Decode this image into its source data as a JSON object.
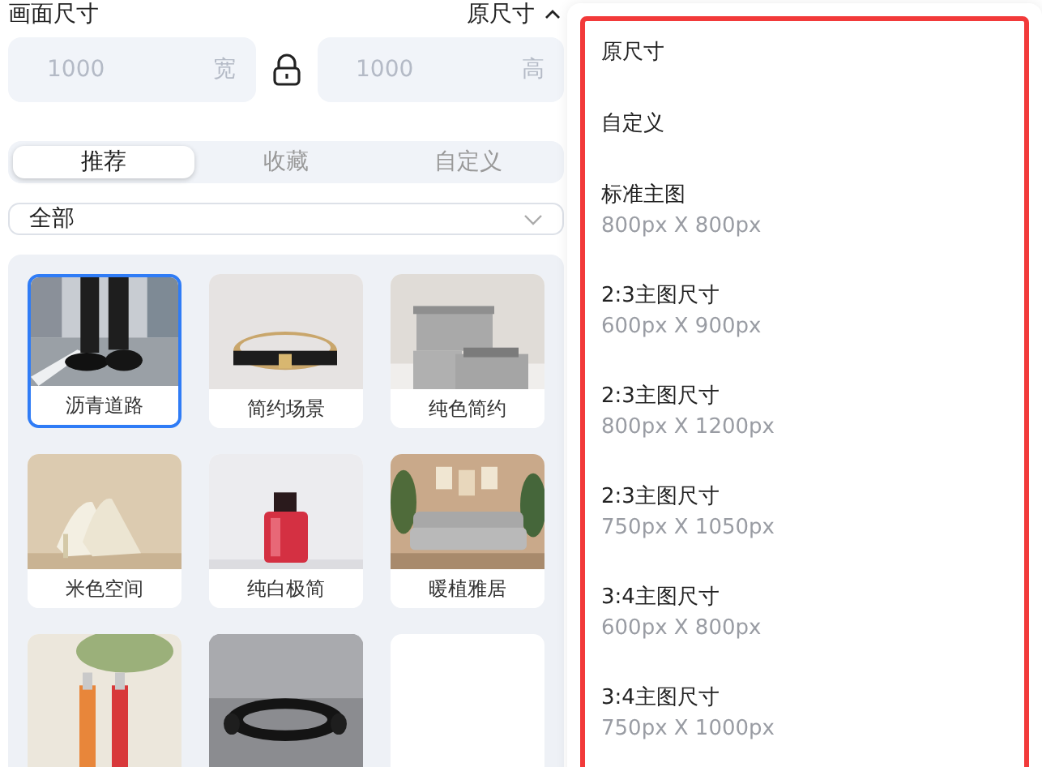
{
  "canvas_size": {
    "label": "画面尺寸",
    "current": "原尺寸",
    "expanded": true
  },
  "width_field": {
    "placeholder": "1000",
    "unit": "宽"
  },
  "height_field": {
    "placeholder": "1000",
    "unit": "高"
  },
  "ratio_locked": true,
  "tabs": [
    {
      "label": "推荐",
      "selected": true
    },
    {
      "label": "收藏",
      "selected": false
    },
    {
      "label": "自定义",
      "selected": false
    }
  ],
  "category_select": {
    "value": "全部"
  },
  "scenes": [
    {
      "label": "沥青道路",
      "selected": true,
      "kind": "picture"
    },
    {
      "label": "简约场景",
      "selected": false,
      "kind": "picture"
    },
    {
      "label": "纯色简约",
      "selected": false,
      "kind": "picture"
    },
    {
      "label": "米色空间",
      "selected": false,
      "kind": "picture"
    },
    {
      "label": "纯白极简",
      "selected": false,
      "kind": "picture"
    },
    {
      "label": "暖植雅居",
      "selected": false,
      "kind": "picture"
    },
    {
      "selected": false,
      "kind": "picture"
    },
    {
      "selected": false,
      "kind": "picture"
    },
    {
      "selected": false,
      "kind": "blank"
    }
  ],
  "size_menu": [
    {
      "label": "原尺寸"
    },
    {
      "label": "自定义"
    },
    {
      "label": "标准主图",
      "size": "800px X 800px"
    },
    {
      "label": "2:3主图尺寸",
      "size": "600px X 900px"
    },
    {
      "label": "2:3主图尺寸",
      "size": "800px X 1200px"
    },
    {
      "label": "2:3主图尺寸",
      "size": "750px X 1050px"
    },
    {
      "label": "3:4主图尺寸",
      "size": "600px X 800px"
    },
    {
      "label": "3:4主图尺寸",
      "size": "750px X 1000px"
    }
  ]
}
